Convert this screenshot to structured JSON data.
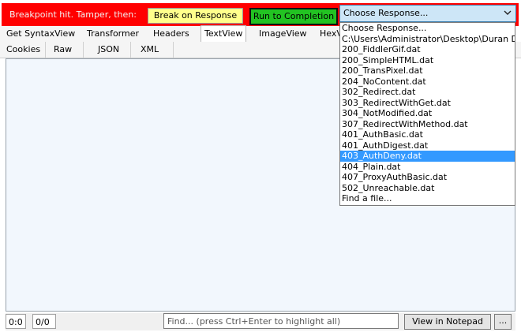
{
  "breakpoint_bar": {
    "label": "Breakpoint hit. Tamper, then:",
    "break_on_response": "Break on Response",
    "run_to_completion": "Run to Completion",
    "choose_response_value": "Choose Response..."
  },
  "tabs_row1": [
    "Get SyntaxView",
    "Transformer",
    "Headers",
    "TextView",
    "ImageView",
    "HexV"
  ],
  "tabs_row2": [
    "Cookies",
    "Raw",
    "JSON",
    "XML"
  ],
  "active_tab": "TextView",
  "dropdown": {
    "items": [
      "Choose Response...",
      "C:\\Users\\Administrator\\Desktop\\Duran Duran",
      "200_FiddlerGif.dat",
      "200_SimpleHTML.dat",
      "200_TransPixel.dat",
      "204_NoContent.dat",
      "302_Redirect.dat",
      "303_RedirectWithGet.dat",
      "304_NotModified.dat",
      "307_RedirectWithMethod.dat",
      "401_AuthBasic.dat",
      "401_AuthDigest.dat",
      "403_AuthDeny.dat",
      "404_Plain.dat",
      "407_ProxyAuthBasic.dat",
      "502_Unreachable.dat",
      "Find a file..."
    ],
    "selected": "403_AuthDeny.dat"
  },
  "status": {
    "position": "0:0",
    "count": "0/0",
    "find_placeholder": "Find... (press Ctrl+Enter to highlight all)",
    "view_in_notepad": "View in Notepad",
    "more": "..."
  },
  "colors": {
    "breakpoint_bar": "#ff0000",
    "break_button": "#ffff8c",
    "run_button": "#22c322",
    "select_bg": "#cde6f7",
    "content_bg": "#f2f7fd",
    "selection": "#3399ff"
  },
  "icons": {
    "select_arrow": "chevron-down-icon"
  }
}
